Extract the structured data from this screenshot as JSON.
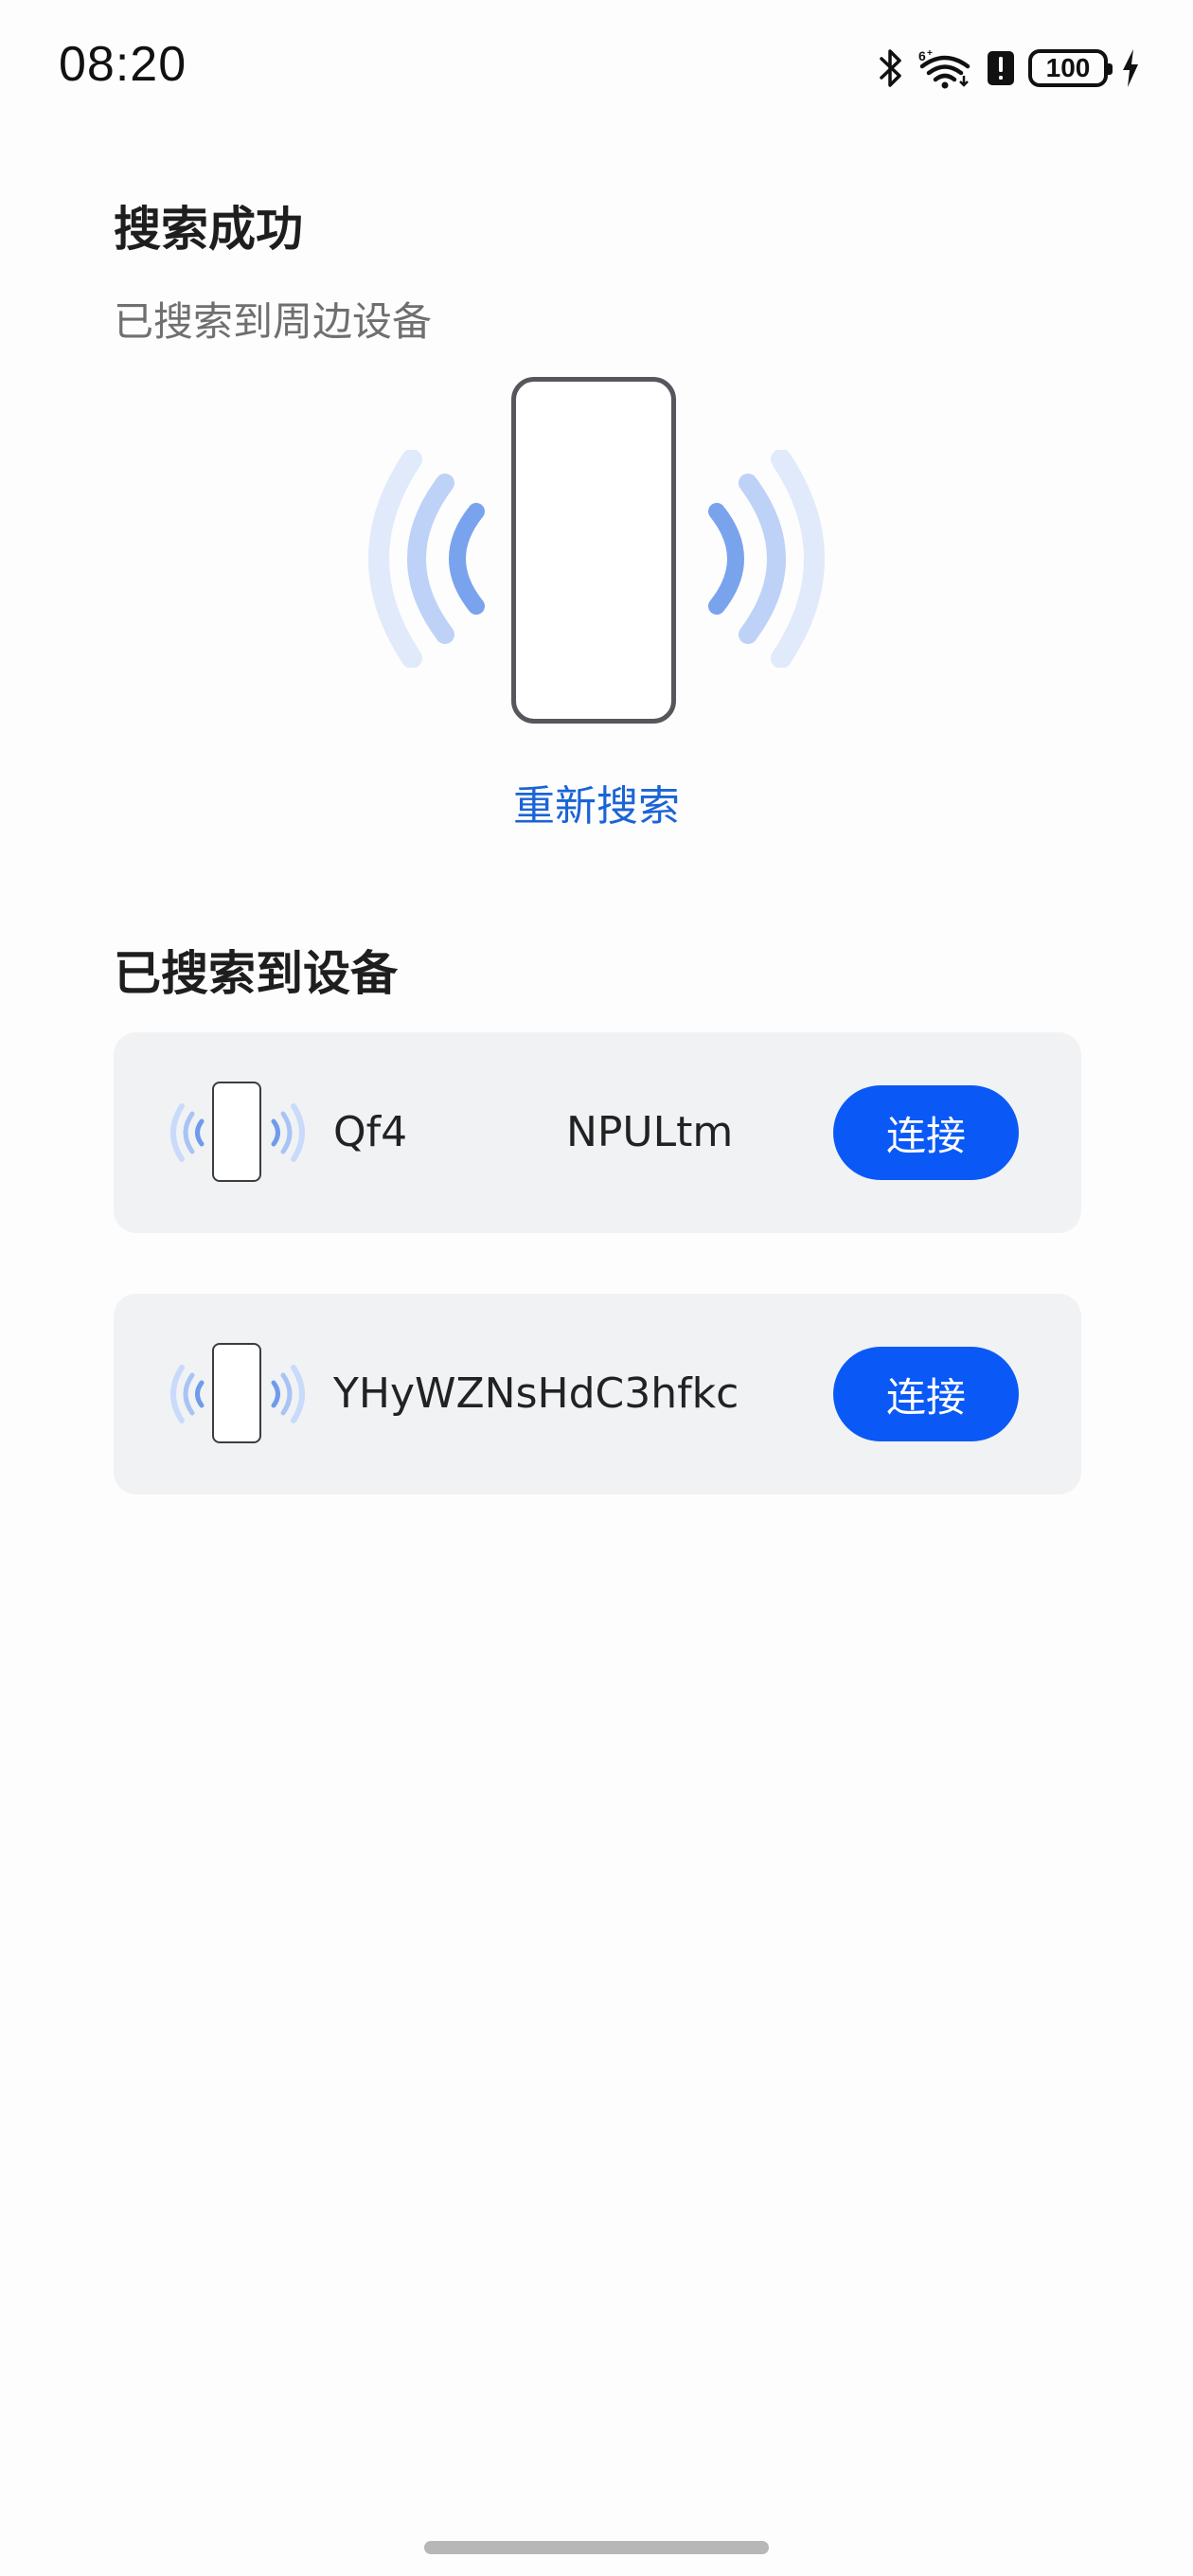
{
  "status_bar": {
    "time": "08:20",
    "battery": "100",
    "icons": [
      "bluetooth-icon",
      "wifi-6-icon",
      "alert-icon",
      "battery-icon",
      "charging-bolt-icon"
    ]
  },
  "search": {
    "title": "搜索成功",
    "subtitle": "已搜索到周边设备",
    "research_label": "重新搜索"
  },
  "devices_section": {
    "title": "已搜索到设备",
    "devices": [
      {
        "name": "Qf4            NPULtm",
        "action": "连接"
      },
      {
        "name": "YHyWZNsHdC3hfkc",
        "action": "连接"
      }
    ]
  },
  "colors": {
    "accent": "#0a59f7",
    "link": "#1a64d6",
    "card_bg": "#f1f2f4",
    "wave": "#7aa3ee"
  }
}
